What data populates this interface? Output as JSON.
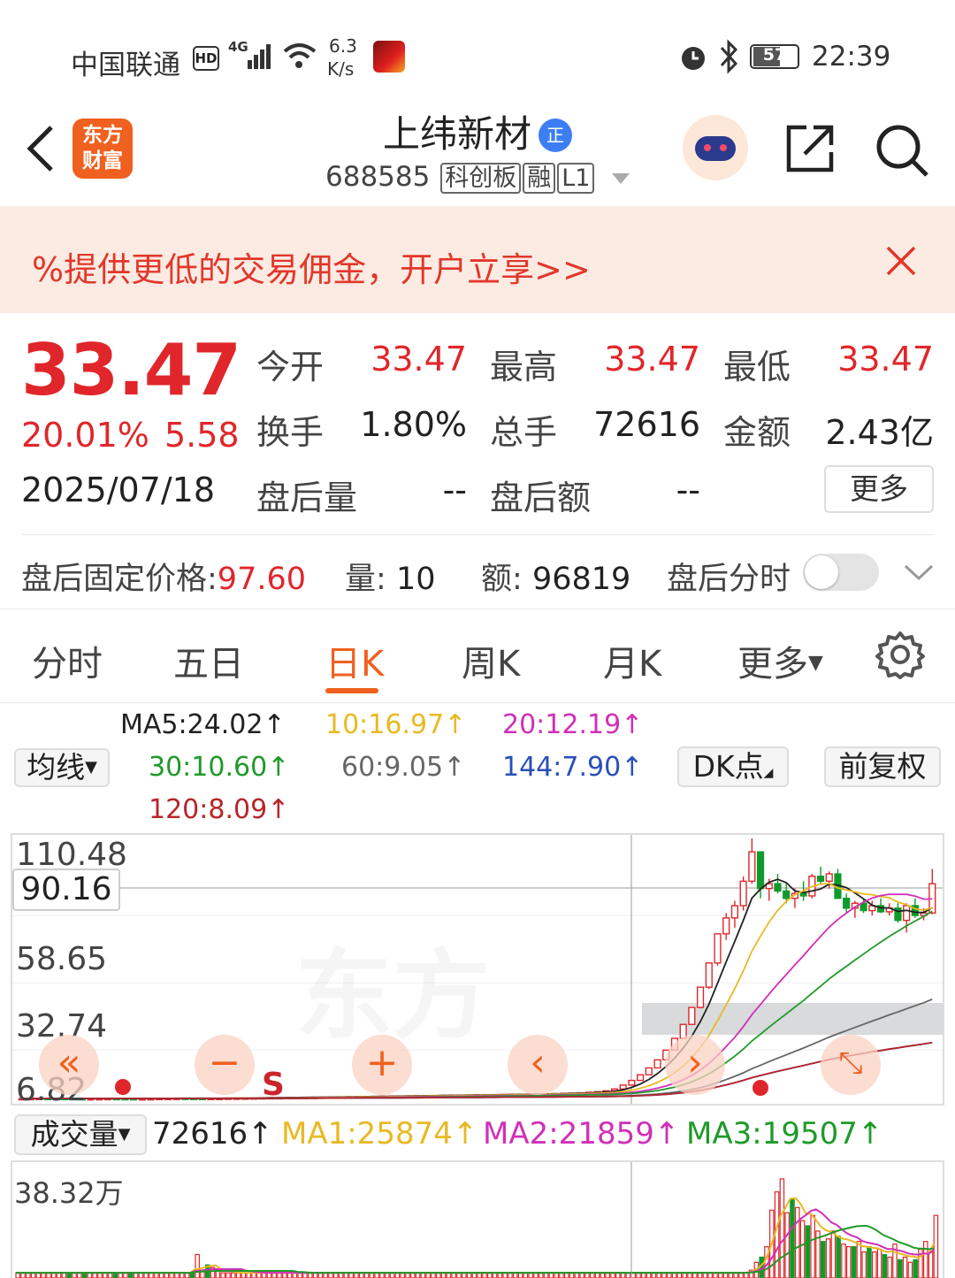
{
  "status_bar": {
    "carrier": "中国联通",
    "hd": "HD",
    "net": "4G",
    "speed_top": "6.3",
    "speed_bottom": "K/s",
    "battery": "57",
    "time": "22:39"
  },
  "header": {
    "logo_line1": "东方",
    "logo_line2": "财富",
    "stock_name": "上纬新材",
    "badge": "正",
    "code": "688585",
    "tags": [
      "科创板",
      "融",
      "L1"
    ]
  },
  "banner": {
    "text": "%提供更低的交易佣金，开户立享>>"
  },
  "quote": {
    "price": "33.47",
    "change_pct": "20.01%",
    "change_amt": "5.58",
    "date": "2025/07/18",
    "open_label": "今开",
    "open": "33.47",
    "high_label": "最高",
    "high": "33.47",
    "low_label": "最低",
    "low": "33.47",
    "turnover_label": "换手",
    "turnover": "1.80%",
    "volume_label": "总手",
    "volume": "72616",
    "amount_label": "金额",
    "amount": "2.43亿",
    "after_vol_label": "盘后量",
    "after_vol": "--",
    "after_amt_label": "盘后额",
    "after_amt": "--",
    "more": "更多"
  },
  "after_hours": {
    "price_label": "盘后固定价格:",
    "price": "97.60",
    "vol_label": "量:",
    "vol": "10",
    "amt_label": "额:",
    "amt": "96819",
    "toggle_label": "盘后分时"
  },
  "tabs": [
    "分时",
    "五日",
    "日K",
    "周K",
    "月K",
    "更多"
  ],
  "ma": {
    "selector": "均线",
    "ma5": "MA5:24.02↑",
    "ma10": "10:16.97↑",
    "ma20": "20:12.19↑",
    "ma30": "30:10.60↑",
    "ma60": "60:9.05↑",
    "ma144": "144:7.90↑",
    "ma120": "120:8.09↑",
    "dk": "DK点",
    "adjust": "前复权"
  },
  "colors": {
    "up": "#e0262a",
    "down": "#0f9b2b",
    "accent": "#f0601f",
    "ma5": "#222222",
    "ma10": "#e8b923",
    "ma20": "#d12fb8",
    "ma30": "#1f9a2a",
    "ma60": "#666666",
    "ma144": "#2a4fb8",
    "ma120": "#b8252a"
  },
  "chart_data": {
    "type": "candlestick",
    "y_ticks": [
      "110.48",
      "58.65",
      "32.74",
      "6.82"
    ],
    "crosshair_value": "90.16",
    "markers": [
      "S"
    ],
    "ohlc": [
      [
        4.2,
        4.3,
        4.1,
        4.2
      ],
      [
        4.2,
        4.3,
        4.1,
        4.25
      ],
      [
        4.25,
        4.35,
        4.2,
        4.3
      ],
      [
        4.3,
        4.4,
        4.2,
        4.25
      ],
      [
        4.25,
        4.3,
        4.2,
        4.28
      ],
      [
        4.28,
        4.35,
        4.2,
        4.22
      ],
      [
        4.22,
        4.3,
        4.15,
        4.2
      ],
      [
        4.2,
        4.25,
        4.1,
        4.15
      ],
      [
        4.15,
        4.2,
        4.1,
        4.18
      ],
      [
        4.18,
        4.25,
        4.1,
        4.2
      ],
      [
        4.2,
        4.3,
        4.15,
        4.25
      ],
      [
        4.25,
        4.3,
        4.2,
        4.22
      ],
      [
        4.22,
        4.28,
        4.15,
        4.2
      ],
      [
        4.2,
        4.25,
        4.1,
        4.12
      ],
      [
        4.12,
        4.2,
        4.05,
        4.15
      ],
      [
        4.15,
        4.2,
        4.1,
        4.18
      ],
      [
        4.18,
        4.3,
        4.15,
        4.28
      ],
      [
        4.28,
        4.35,
        4.2,
        4.3
      ],
      [
        4.3,
        4.38,
        4.25,
        4.35
      ],
      [
        4.35,
        4.4,
        4.3,
        4.32
      ],
      [
        4.32,
        4.4,
        4.25,
        4.3
      ],
      [
        4.3,
        4.35,
        4.2,
        4.25
      ],
      [
        4.25,
        4.3,
        4.2,
        4.28
      ],
      [
        4.28,
        4.35,
        4.22,
        4.3
      ],
      [
        4.3,
        4.4,
        4.25,
        4.38
      ],
      [
        4.38,
        4.45,
        4.3,
        4.4
      ],
      [
        4.4,
        4.5,
        4.35,
        4.45
      ],
      [
        4.45,
        4.55,
        4.4,
        4.5
      ],
      [
        4.5,
        4.6,
        4.45,
        4.55
      ],
      [
        4.55,
        4.6,
        4.5,
        4.58
      ],
      [
        4.58,
        4.65,
        4.5,
        4.6
      ],
      [
        4.6,
        4.7,
        4.55,
        4.65
      ],
      [
        4.65,
        4.7,
        4.6,
        4.68
      ],
      [
        4.68,
        4.75,
        4.6,
        4.7
      ],
      [
        4.7,
        4.8,
        4.65,
        4.75
      ],
      [
        4.75,
        4.85,
        4.7,
        4.8
      ],
      [
        4.8,
        4.9,
        4.75,
        4.85
      ],
      [
        4.85,
        4.95,
        4.8,
        4.9
      ],
      [
        4.9,
        5.0,
        4.85,
        4.95
      ],
      [
        4.95,
        5.05,
        4.9,
        5.0
      ],
      [
        5.0,
        5.1,
        4.95,
        5.05
      ],
      [
        5.05,
        5.15,
        5.0,
        5.1
      ],
      [
        5.1,
        5.2,
        5.05,
        5.15
      ],
      [
        5.15,
        5.25,
        5.1,
        5.2
      ],
      [
        5.2,
        5.3,
        5.15,
        5.25
      ],
      [
        5.25,
        5.35,
        5.2,
        5.3
      ],
      [
        5.3,
        5.4,
        5.25,
        5.35
      ],
      [
        5.35,
        5.45,
        5.3,
        5.4
      ],
      [
        5.4,
        5.5,
        5.35,
        5.45
      ],
      [
        5.45,
        5.55,
        5.4,
        5.5
      ],
      [
        5.5,
        5.6,
        5.45,
        5.55
      ],
      [
        5.55,
        5.65,
        5.5,
        5.6
      ],
      [
        5.6,
        5.7,
        5.55,
        5.65
      ],
      [
        5.65,
        5.75,
        5.6,
        5.7
      ],
      [
        5.7,
        5.8,
        5.65,
        5.75
      ],
      [
        5.75,
        5.85,
        5.7,
        5.8
      ],
      [
        5.8,
        5.9,
        5.75,
        5.85
      ],
      [
        5.85,
        5.95,
        5.8,
        5.9
      ],
      [
        5.9,
        6.0,
        5.85,
        5.95
      ],
      [
        5.95,
        6.05,
        5.9,
        6.0
      ],
      [
        6.0,
        6.1,
        5.95,
        6.05
      ],
      [
        6.05,
        6.2,
        6.0,
        6.15
      ],
      [
        6.15,
        6.3,
        6.1,
        6.25
      ],
      [
        6.25,
        6.35,
        6.2,
        6.3
      ],
      [
        6.3,
        6.45,
        6.25,
        6.4
      ],
      [
        6.4,
        6.6,
        6.35,
        6.55
      ],
      [
        6.55,
        6.8,
        6.5,
        6.75
      ],
      [
        6.75,
        7.1,
        6.7,
        7.0
      ],
      [
        7.0,
        7.4,
        6.95,
        7.35
      ],
      [
        7.35,
        8.2,
        7.3,
        8.1
      ],
      [
        8.1,
        9.7,
        8.0,
        9.7
      ],
      [
        9.7,
        11.6,
        9.6,
        11.6
      ],
      [
        11.6,
        13.9,
        11.5,
        13.9
      ],
      [
        13.9,
        16.7,
        13.8,
        16.7
      ],
      [
        16.7,
        20.0,
        16.6,
        20.0
      ],
      [
        20.0,
        24.0,
        19.9,
        24.0
      ],
      [
        24.0,
        28.8,
        23.9,
        28.8
      ],
      [
        28.8,
        34.5,
        28.6,
        34.5
      ],
      [
        34.5,
        41.4,
        34.3,
        41.4
      ],
      [
        41.4,
        49.7,
        41.0,
        49.7
      ],
      [
        49.7,
        59.6,
        49.0,
        59.6
      ],
      [
        59.6,
        71.5,
        58.5,
        71.5
      ],
      [
        71.5,
        80.0,
        69.0,
        78.0
      ],
      [
        78.0,
        85.0,
        74.0,
        83.0
      ],
      [
        83.0,
        95.0,
        81.0,
        93.0
      ],
      [
        93.0,
        110.48,
        92.0,
        105.0
      ],
      [
        105.0,
        100.0,
        86.0,
        90.0
      ],
      [
        90.0,
        94.0,
        85.0,
        92.0
      ],
      [
        92.0,
        96.0,
        88.0,
        89.0
      ],
      [
        89.0,
        92.0,
        84.0,
        86.0
      ],
      [
        86.0,
        90.0,
        82.0,
        88.0
      ],
      [
        88.0,
        93.0,
        85.0,
        87.0
      ],
      [
        87.0,
        96.0,
        86.0,
        95.0
      ],
      [
        95.0,
        99.0,
        92.0,
        93.0
      ],
      [
        93.0,
        97.0,
        90.0,
        96.0
      ],
      [
        96.0,
        98.0,
        86.0,
        86.0
      ],
      [
        86.0,
        88.0,
        80.0,
        82.0
      ],
      [
        82.0,
        85.0,
        78.0,
        84.0
      ],
      [
        84.0,
        86.0,
        80.0,
        81.0
      ],
      [
        81.0,
        85.0,
        79.0,
        83.0
      ],
      [
        83.0,
        86.0,
        80.0,
        80.5
      ],
      [
        80.5,
        84.0,
        79.0,
        82.0
      ],
      [
        82.0,
        84.0,
        76.0,
        77.0
      ],
      [
        77.0,
        84.0,
        72.0,
        83.0
      ],
      [
        83.0,
        86.0,
        78.0,
        79.0
      ],
      [
        79.0,
        82.0,
        77.0,
        80.0
      ],
      [
        80.0,
        98.0,
        79.5,
        92.0
      ]
    ],
    "volume_legend": {
      "selector": "成交量",
      "vol": "72616↑",
      "ma1": "MA1:25874↑",
      "ma2": "MA2:21859↑",
      "ma3": "MA3:19507↑",
      "max_label": "38.32万"
    },
    "volume": [
      2,
      2,
      2,
      2,
      2,
      2,
      2,
      2,
      2,
      2,
      2,
      2,
      2,
      2,
      2,
      2,
      2,
      2,
      2,
      2,
      2,
      2,
      2,
      2,
      2,
      2,
      2,
      2,
      2,
      2,
      2,
      2,
      2,
      2,
      2,
      9,
      3,
      5,
      4,
      3,
      2,
      2,
      2,
      2,
      2,
      2,
      2,
      2,
      2,
      2,
      2,
      2,
      2,
      2,
      2,
      2,
      2,
      2,
      2,
      2,
      2,
      2,
      2,
      2,
      2,
      2,
      2,
      2,
      2,
      2,
      2,
      2,
      2,
      2,
      2,
      2,
      2,
      2,
      2,
      2,
      2,
      2,
      2,
      2,
      2,
      2,
      2,
      2,
      2,
      2,
      2,
      2,
      2,
      2,
      2,
      2,
      2,
      2,
      2,
      2,
      2,
      2,
      2,
      2,
      2,
      2,
      2,
      2,
      2,
      2,
      2,
      2,
      2,
      2,
      2,
      2,
      2,
      2,
      2,
      2,
      2,
      2,
      2,
      2,
      2,
      2,
      2,
      2,
      2,
      2,
      2,
      2,
      2,
      2,
      2,
      2,
      2,
      2,
      2,
      2,
      2,
      2,
      2,
      3,
      6,
      8,
      12,
      26,
      33,
      38,
      25,
      30,
      27,
      22,
      20,
      24,
      18,
      14,
      15,
      18,
      16,
      13,
      12,
      12,
      14,
      10,
      12,
      10,
      11,
      9,
      8,
      13,
      7,
      8,
      6,
      7,
      11,
      14,
      10,
      24
    ]
  }
}
